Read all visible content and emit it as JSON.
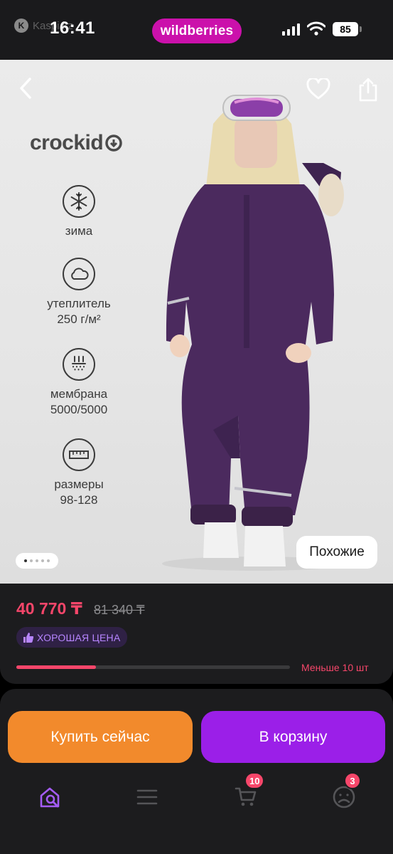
{
  "status_bar": {
    "back_app_label": "Kaspi.kz",
    "time": "16:41",
    "app_name": "wildberries",
    "battery_level": "85"
  },
  "product_image": {
    "brand": "crockid",
    "features": [
      {
        "icon": "snowflake-icon",
        "label": "зима",
        "value": ""
      },
      {
        "icon": "cloud-icon",
        "label": "утеплитель",
        "value": "250 г/м²"
      },
      {
        "icon": "membrane-icon",
        "label": "мембрана",
        "value": "5000/5000"
      },
      {
        "icon": "ruler-icon",
        "label": "размеры",
        "value": "98-128"
      }
    ],
    "gallery_total": 5,
    "gallery_active": 1,
    "similar_label": "Похожие"
  },
  "pricing": {
    "price": "40 770 ₸",
    "old_price": "81 340 ₸",
    "badge": "ХОРОШАЯ ЦЕНА",
    "stock_fraction": 0.29,
    "stock_text": "Меньше 10 шт"
  },
  "actions": {
    "buy_now": "Купить сейчас",
    "add_to_cart": "В корзину"
  },
  "tab_bar": {
    "cart_badge": "10",
    "profile_badge": "3"
  },
  "colors": {
    "accent_purple": "#9b1fe8",
    "buy_orange": "#f28a2c",
    "price_red": "#f6466a",
    "brand_magenta": "#cb11ab",
    "garment_purple": "#4b2a5e"
  }
}
